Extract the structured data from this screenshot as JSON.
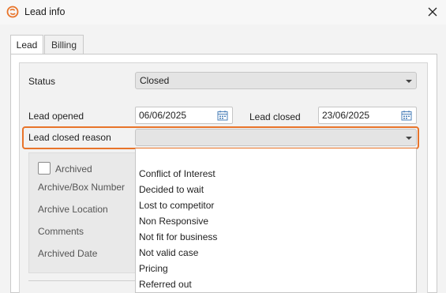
{
  "window": {
    "title": "Lead info"
  },
  "tabs": [
    {
      "label": "Lead"
    },
    {
      "label": "Billing"
    }
  ],
  "form": {
    "status_label": "Status",
    "status_value": "Closed",
    "lead_opened_label": "Lead opened",
    "lead_opened_value": "06/06/2025",
    "lead_closed_label": "Lead closed",
    "lead_closed_value": "23/06/2025",
    "closed_reason_label": "Lead closed reason",
    "closed_reason_value": ""
  },
  "archive": {
    "archived_label": "Archived",
    "archived_checked": false,
    "box_number_label": "Archive/Box Number",
    "location_label": "Archive Location",
    "comments_label": "Comments",
    "date_label": "Archived Date"
  },
  "dropdown": {
    "options": [
      "Conflict of Interest",
      "Decided to wait",
      "Lost to competitor",
      "Non Responsive",
      "Not fit for business",
      "Not valid case",
      "Pricing",
      "Referred out"
    ]
  },
  "colors": {
    "highlight": "#e8742a",
    "brand": "#e8742a"
  },
  "icons": {
    "app": "app-logo-icon",
    "close": "close-icon",
    "calendar": "calendar-icon",
    "dropdown": "chevron-down-icon"
  }
}
